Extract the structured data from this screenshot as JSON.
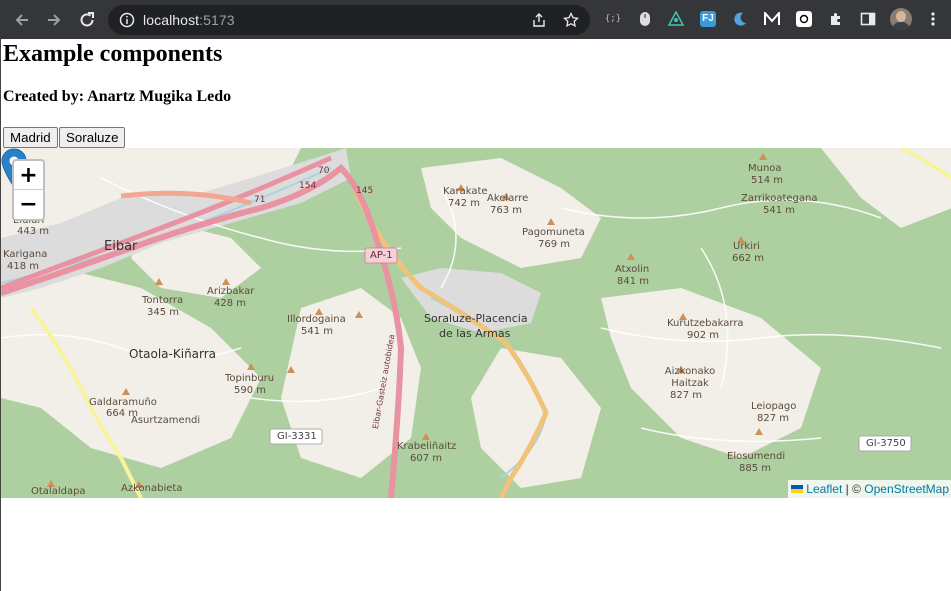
{
  "browser": {
    "url_host": "localhost",
    "url_port": ":5173"
  },
  "page": {
    "title": "Example components",
    "author": "Created by: Anartz Mugika Ledo",
    "buttons": [
      "Madrid",
      "Soraluze"
    ]
  },
  "map": {
    "marker_label_line1": "Soraluze-Placencia",
    "marker_label_line2": "de las Armas",
    "zoom_in": "+",
    "zoom_out": "−",
    "attribution": {
      "leaflet": "Leaflet",
      "separator": " | © ",
      "osm": "OpenStreetMap"
    },
    "places": [
      {
        "name": "Eibar",
        "elev": ""
      },
      {
        "name": "Otaola-Kiñarra",
        "elev": ""
      },
      {
        "name": "Karakate",
        "elev": "742 m"
      },
      {
        "name": "Akelarre",
        "elev": "763 m"
      },
      {
        "name": "Pagomuneta",
        "elev": "769 m"
      },
      {
        "name": "Munoa",
        "elev": "514 m"
      },
      {
        "name": "Zarrikoategana",
        "elev": "541 m"
      },
      {
        "name": "Urkiri",
        "elev": "662 m"
      },
      {
        "name": "Atxolin",
        "elev": "841 m"
      },
      {
        "name": "Kurutzebakarra",
        "elev": "902 m"
      },
      {
        "name": "Aizkonako Haitzak",
        "elev": "827 m"
      },
      {
        "name": "Leiopago",
        "elev": "827 m"
      },
      {
        "name": "Elosumendi",
        "elev": "885 m"
      },
      {
        "name": "Arizbakar",
        "elev": "428 m"
      },
      {
        "name": "Tontorra",
        "elev": "345 m"
      },
      {
        "name": "Illordogaina",
        "elev": "541 m"
      },
      {
        "name": "Topinburu",
        "elev": "590 m"
      },
      {
        "name": "Galdaramuño",
        "elev": "664 m"
      },
      {
        "name": "Asurtzamendi",
        "elev": ""
      },
      {
        "name": "Krabeliñaitz",
        "elev": "607 m"
      },
      {
        "name": "Otalaldapa",
        "elev": ""
      },
      {
        "name": "Azkonabieta",
        "elev": ""
      },
      {
        "name": "Karigana",
        "elev": "418 m"
      },
      {
        "name": "Elulari",
        "elev": "443 m"
      }
    ],
    "road_labels": [
      "AP-1",
      "GI-3331",
      "GI-3750",
      "154",
      "145",
      "Eibar-Gasteiz autobidea",
      "70",
      "71"
    ],
    "colors": {
      "forest": "#aed0a0",
      "land": "#f2efe9",
      "motorway": "#e892a2",
      "primary": "#fcd6a4",
      "water": "#aad3df",
      "urban": "#dddddd"
    }
  }
}
